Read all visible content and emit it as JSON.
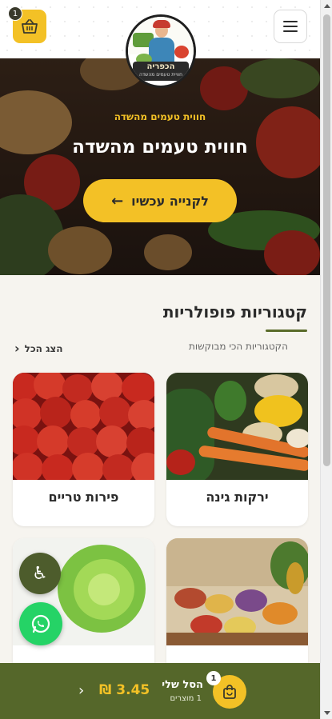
{
  "header": {
    "cart_count": "1",
    "logo_title": "הכפריה",
    "logo_subtitle": "חוויית טעמים מהשדה"
  },
  "hero": {
    "eyebrow": "חווית טעמים מהשדה",
    "title": "חווית טעמים מהשדה",
    "cta_label": "לקנייה עכשיו",
    "cta_arrow": "←"
  },
  "categories": {
    "title": "קטגוריות פופולריות",
    "subtitle": "הקטגוריות הכי מבוקשות",
    "view_all": "הצג הכל",
    "view_all_chevron": "‹",
    "items": [
      {
        "label": "ירקות גינה"
      },
      {
        "label": "פירות טריים"
      },
      {
        "label": ""
      },
      {
        "label": ""
      }
    ]
  },
  "bottom_bar": {
    "title": "הסל שלי",
    "items_count": "1 מוצרים",
    "badge": "1",
    "price": "₪ 3.45",
    "chevron": "‹"
  },
  "fabs": {
    "accessibility_glyph": "♿"
  },
  "colors": {
    "accent": "#f3c126",
    "brand_green": "#55672a",
    "whatsapp": "#25d366"
  }
}
